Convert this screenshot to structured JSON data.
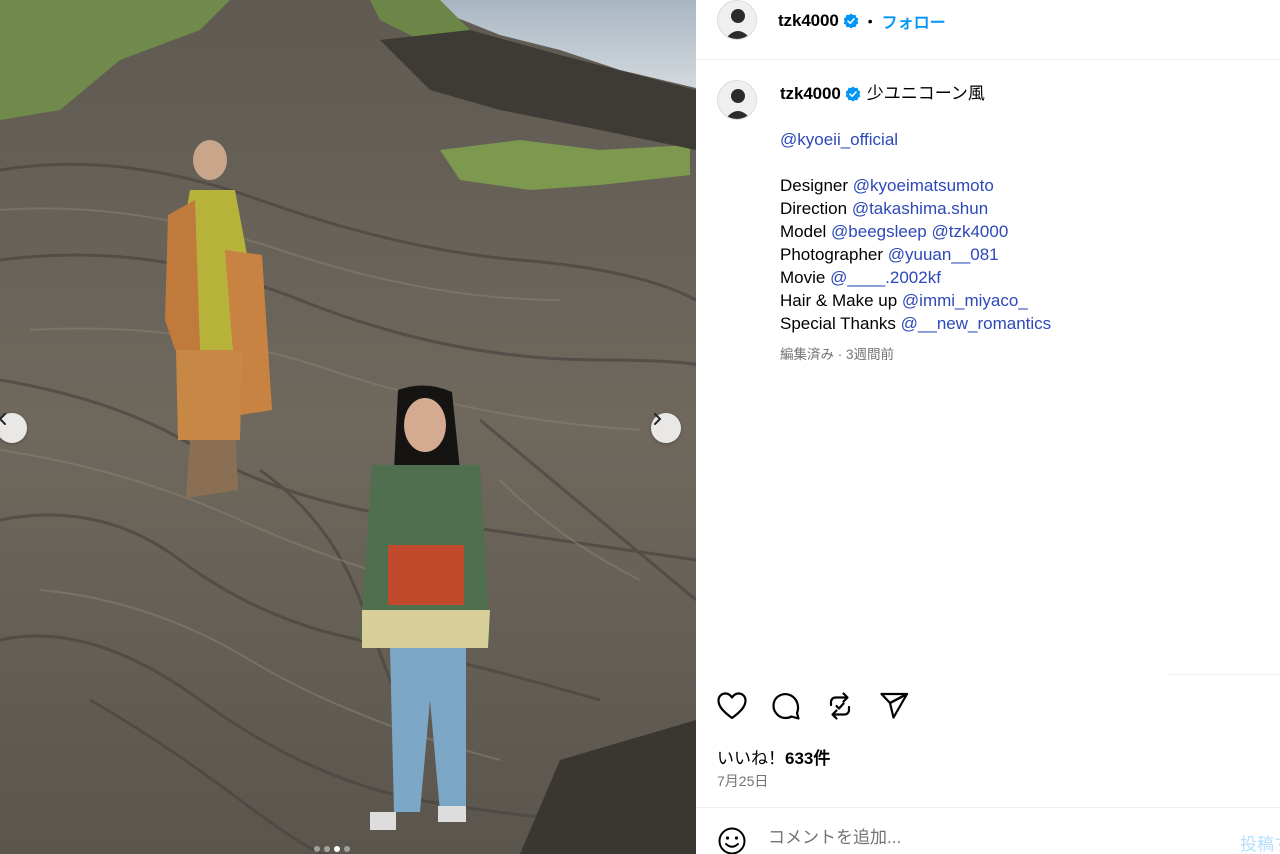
{
  "post": {
    "author": {
      "username": "tzk4000",
      "verified": true,
      "follow_label": "フォロー",
      "separator": "•"
    },
    "caption": {
      "text": "少ユニコーン風",
      "brand_mention": "@kyoeii_official",
      "credits": [
        {
          "role": "Designer",
          "handles": [
            "@kyoeimatsumoto"
          ]
        },
        {
          "role": "Direction",
          "handles": [
            "@takashima.shun"
          ]
        },
        {
          "role": "Model",
          "handles": [
            "@beegsleep",
            "@tzk4000"
          ]
        },
        {
          "role": "Photographer",
          "handles": [
            "@yuuan__081"
          ]
        },
        {
          "role": "Movie",
          "handles": [
            "@____.2002kf"
          ]
        },
        {
          "role": "Hair & Make up",
          "handles": [
            "@immi_miyaco_"
          ]
        },
        {
          "role": "Special Thanks",
          "handles": [
            "@__new_romantics"
          ]
        }
      ],
      "meta": "編集済み · 3週間前"
    },
    "actions": [
      {
        "name": "like",
        "icon": "heart-icon"
      },
      {
        "name": "comment",
        "icon": "comment-bubble-icon"
      },
      {
        "name": "repost",
        "icon": "repost-icon"
      },
      {
        "name": "share",
        "icon": "paper-plane-icon"
      }
    ],
    "likes": {
      "label": "いいね！",
      "count": "633件"
    },
    "date": "7月25日",
    "comment": {
      "placeholder": "コメントを追加...",
      "post_label": "投稿する"
    },
    "carousel": {
      "slide_count": 4,
      "active_index": 2
    }
  },
  "colors": {
    "link": "#2d48b8",
    "follow": "#0095f6",
    "verified": "#0095f6",
    "muted": "#737373"
  }
}
